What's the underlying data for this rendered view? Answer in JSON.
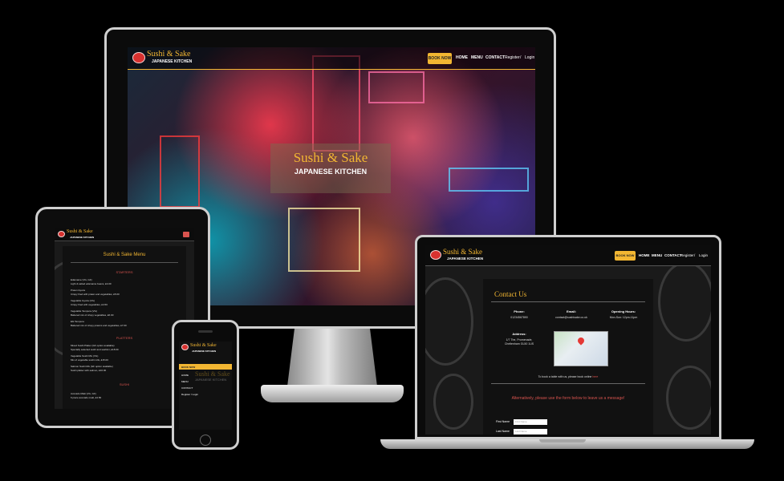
{
  "brand": {
    "name": "Sushi & Sake",
    "sub": "JAPANESE KITCHEN",
    "accent": "#f2b632",
    "logo_red": "#d7312f"
  },
  "nav": {
    "book": "BOOK NOW",
    "home": "HOME",
    "menu": "MENU",
    "contact": "CONTACT",
    "register": "Register",
    "separator": "/",
    "login": "Login"
  },
  "hero": {
    "title": "Sushi & Sake",
    "sub": "JAPANESE KITCHEN"
  },
  "tablet": {
    "heading": "Sushi & Sake Menu",
    "sections": [
      {
        "title": "STARTERS",
        "items": [
          "Edamame (VG, GF)",
          "Light & salted edamame beans, £4.00",
          "Prawn Gyoza",
          "Crispy fried with prawn and vegetables, £5.00",
          "Vegetable Gyoza (VG)",
          "Crispy fried with vegetables, £4.50",
          "Vegetable Tempura (VG)",
          "Battered mix of crispy vegetables, £6.00",
          "Ebi Tempura",
          "Battered mix of crispy prawns and vegetables, £7.00"
        ]
      },
      {
        "title": "PLATTERS",
        "items": [
          "Mixed Sushi Platter (GF option available)",
          "Specially selected sushi and sashimi, £18.00",
          "Vegetable Sushi Mix (VG)",
          "Mix of vegetable sushi rolls, £15.00",
          "Salmon Sushi Mix (GF option available)",
          "Sushi platter with salmon, £16.00"
        ]
      },
      {
        "title": "SUSHI",
        "items": [
          "Avocado Maki (VG, GF)",
          "6 piece avocado maki, £4.50"
        ]
      }
    ]
  },
  "phone": {
    "menu": [
      "BOOK NOW",
      "HOME",
      "MENU",
      "CONTACT",
      "Register / Login"
    ]
  },
  "laptop": {
    "title": "Contact Us",
    "columns": [
      {
        "head": "Phone:",
        "value": "01234567890"
      },
      {
        "head": "Email:",
        "value": "contact@sushisake.co.uk"
      },
      {
        "head": "Opening Hours:",
        "value": "Mon-Sun: 12pm-11pm"
      }
    ],
    "address_head": "Address:",
    "address": "1/7 The, Promenade, Cheltenham GL50 1US",
    "book_line_before": "To book a table with us, please book online",
    "book_link": "here",
    "alt_text": "Alternatively, please use the form below to leave us a message!",
    "first_name_label": "First Name",
    "first_name_placeholder": "First Name",
    "last_name_label": "Last Name",
    "last_name_placeholder": "Last Name"
  }
}
